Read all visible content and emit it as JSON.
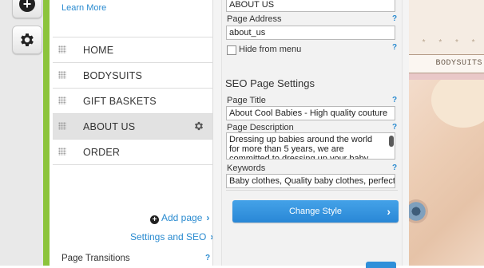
{
  "toolbar": {
    "add_icon": "plus-circle-icon",
    "settings_icon": "gear-icon"
  },
  "pages_panel": {
    "learn_more": "Learn More",
    "pages": [
      {
        "label": "HOME",
        "selected": false
      },
      {
        "label": "BODYSUITS",
        "selected": false
      },
      {
        "label": "GIFT BASKETS",
        "selected": false
      },
      {
        "label": "ABOUT US",
        "selected": true
      },
      {
        "label": "ORDER",
        "selected": false
      }
    ],
    "add_page": "Add page",
    "settings_and_seo": "Settings and SEO",
    "page_transitions": "Page Transitions",
    "help": "?"
  },
  "settings": {
    "page_name_value": "ABOUT US",
    "page_address_label": "Page Address",
    "page_address_value": "about_us",
    "hide_from_menu": "Hide from menu",
    "hide_from_menu_checked": false,
    "seo_title": "SEO Page Settings",
    "page_title_label": "Page Title",
    "page_title_value": "About Cool Babies - High quality couture",
    "page_description_label": "Page Description",
    "page_description_value": "Dressing up babies around the world for more than 5 years, we are committed to dressing up your baby with only beautiful",
    "keywords_label": "Keywords",
    "keywords_value": "Baby clothes, Quality baby clothes, perfect",
    "change_style": "Change Style",
    "help": "?"
  },
  "site_preview": {
    "nav_item": "BODYSUITS",
    "stars": "* * * * * *"
  },
  "colors": {
    "accent_green": "#8cc43c",
    "link_blue": "#2a8bd0",
    "button_blue": "#2f8fd9",
    "selected_row": "#e2e2e2"
  }
}
